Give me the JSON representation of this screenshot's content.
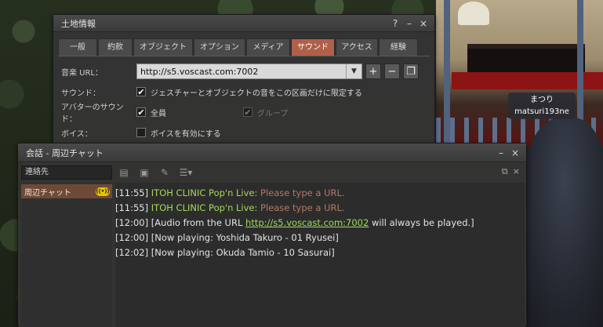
{
  "world": {
    "nametag": {
      "display_name": "まつり",
      "username": "matsuri193ne"
    }
  },
  "land_window": {
    "title": "土地情報",
    "title_buttons": {
      "help": "?",
      "minimize": "–",
      "close": "×"
    },
    "tabs": [
      {
        "label": "一般",
        "active": false
      },
      {
        "label": "約款",
        "active": false
      },
      {
        "label": "オブジェクト",
        "active": false
      },
      {
        "label": "オプション",
        "active": false
      },
      {
        "label": "メディア",
        "active": false
      },
      {
        "label": "サウンド",
        "active": true
      },
      {
        "label": "アクセス",
        "active": false
      },
      {
        "label": "経験",
        "active": false
      }
    ],
    "music_url": {
      "label": "音楽 URL：",
      "value": "http://s5.voscast.com:7002"
    },
    "sound": {
      "label": "サウンド：",
      "checkbox_label": "ジェスチャーとオブジェクトの音をこの区画だけに限定する",
      "checked": true
    },
    "avatar_sound": {
      "label": "アバターのサウンド：",
      "everyone_label": "全員",
      "everyone_checked": true,
      "group_label": "グループ",
      "group_checked": true
    },
    "voice": {
      "label": "ボイス：",
      "checkbox_label": "ボイスを有効にする",
      "checked": false
    }
  },
  "chat_window": {
    "title": "会話 - 周辺チャット",
    "title_buttons": {
      "minimize": "–",
      "close": "×"
    },
    "contacts_header": "連絡先",
    "contacts": [
      {
        "label": "周辺チャット",
        "badge": "((•))"
      }
    ],
    "messages": [
      {
        "time": "[11:55]",
        "speaker": "ITOH CLINIC Pop'n Live:",
        "text": " Please type a URL."
      },
      {
        "time": "[11:55]",
        "speaker": "ITOH CLINIC Pop'n Live:",
        "text": " Please type a URL."
      },
      {
        "time": "[12:00]",
        "pre": " [Audio from the URL ",
        "link": "http://s5.voscast.com:7002",
        "post": " will always be played.]"
      },
      {
        "time": "[12:00]",
        "plain": " [Now playing: Yoshida Takuro - 01 Ryusei]"
      },
      {
        "time": "[12:02]",
        "plain": " [Now playing: Okuda Tamio - 10 Sasurai]"
      }
    ]
  },
  "colors": {
    "active_tab": "#b05f49",
    "object_speaker": "#a6d85c",
    "system_error": "#b27a62",
    "link": "#9edb5c",
    "voice_badge": "#e7c20a",
    "selected_contact": "#6e4a36"
  }
}
